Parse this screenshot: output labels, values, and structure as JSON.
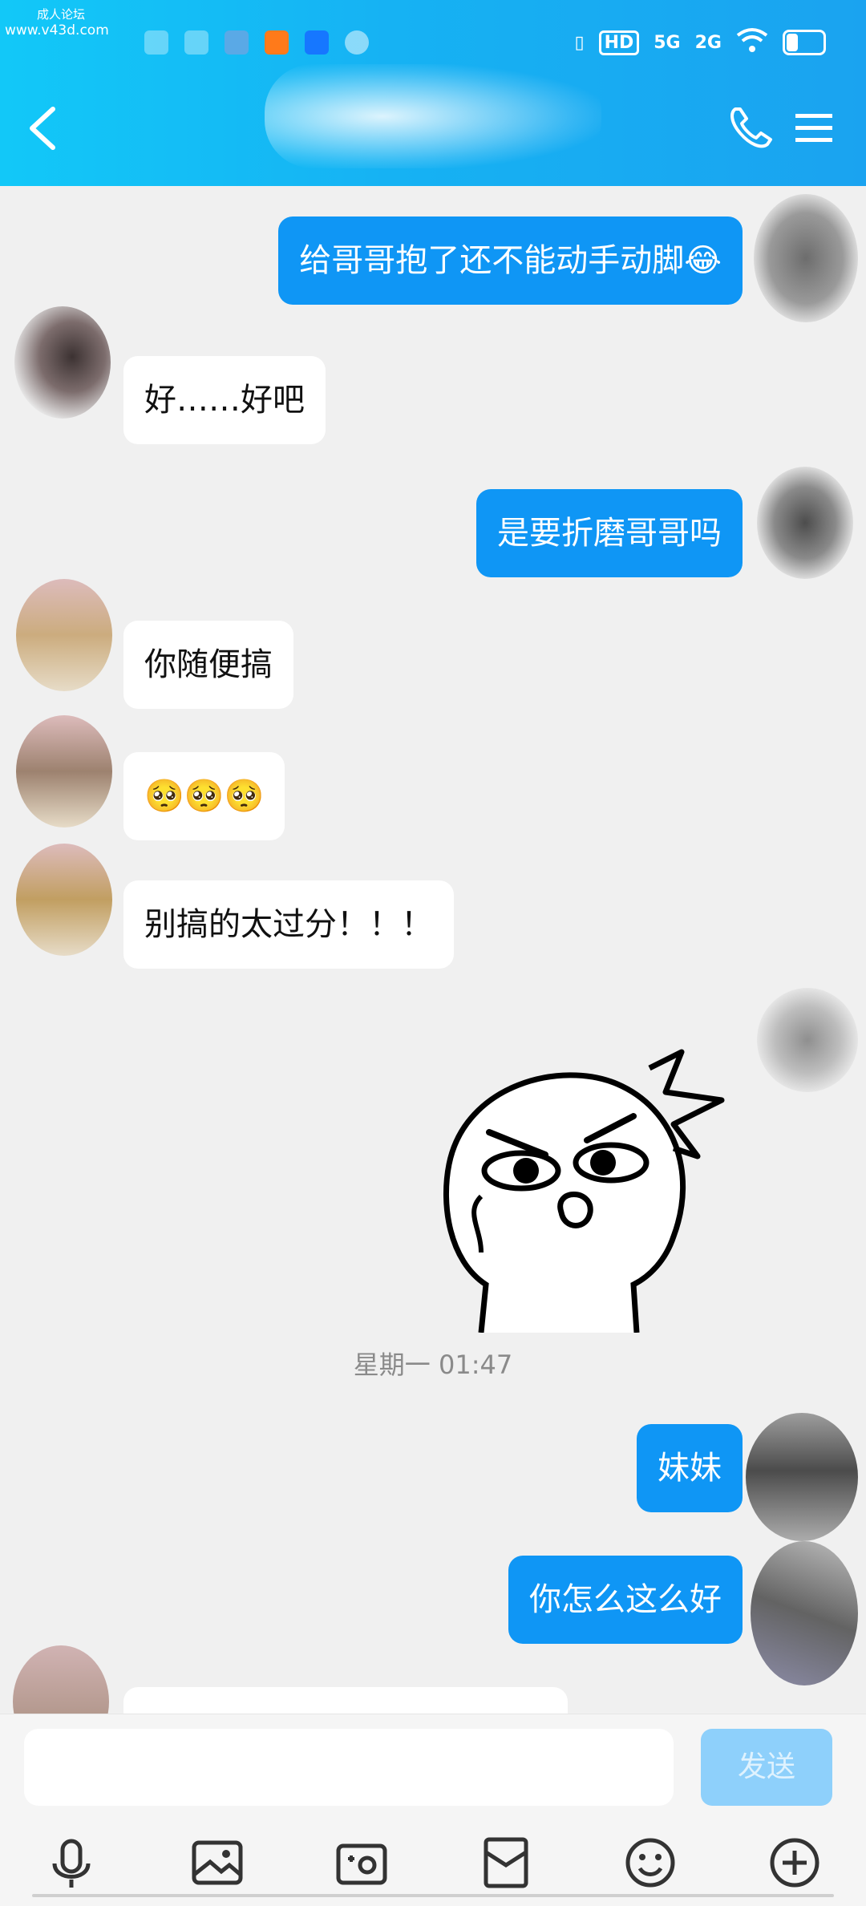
{
  "watermark": {
    "line1": "成人论坛",
    "line2": "www.v43d.com"
  },
  "status_bar": {
    "network_hd": "HD",
    "sim1": "5G",
    "sim2": "2G"
  },
  "colors": {
    "header": "#16b2f3",
    "bubble_out": "#0f96f5",
    "bubble_in": "#ffffff",
    "background": "#f0f0f0",
    "send_disabled": "#8ed0fb"
  },
  "header": {
    "back_icon": "back-chevron-icon",
    "call_icon": "phone-icon",
    "menu_icon": "menu-icon"
  },
  "messages": [
    {
      "side": "out",
      "text": "给哥哥抱了还不能动手动脚😂"
    },
    {
      "side": "in",
      "text": "好……好吧"
    },
    {
      "side": "out",
      "text": "是要折磨哥哥吗"
    },
    {
      "side": "in",
      "text": "你随便搞"
    },
    {
      "side": "in",
      "text": "🥺🥺🥺"
    },
    {
      "side": "in",
      "text": "别搞的太过分！！！"
    },
    {
      "side": "out",
      "type": "sticker",
      "sticker": "angry-face-sticker"
    },
    {
      "side": "out",
      "text": "妹妹"
    },
    {
      "side": "out",
      "text": "你怎么这么好"
    }
  ],
  "timestamp": "星期一 01:47",
  "input": {
    "placeholder": "",
    "send_label": "发送"
  },
  "toolbar": [
    "microphone-icon",
    "image-icon",
    "camera-icon",
    "red-packet-icon",
    "emoji-icon",
    "plus-icon"
  ]
}
